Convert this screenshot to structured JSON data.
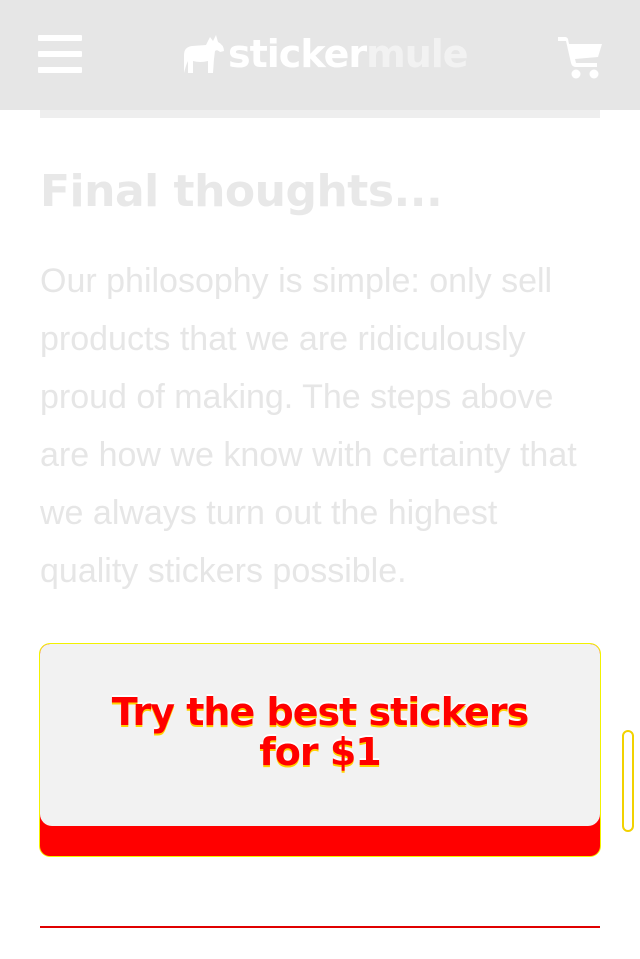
{
  "header": {
    "logo": {
      "part1": "sticker",
      "part2": "mule"
    },
    "menu_icon": "hamburger-menu-icon",
    "cart_icon": "shopping-cart-icon"
  },
  "article": {
    "heading": "Final thoughts...",
    "paragraph": "Our philosophy is simple: only sell products that we are ridiculously proud of making. The steps above are how we know with certainty that we always turn out the highest quality stickers possible."
  },
  "cta": {
    "line1": "Try the best stickers",
    "line2": "for $1"
  },
  "colors": {
    "header_bg": "#e6e6e6",
    "accent_red": "#ff0000",
    "faded_text": "#e6e6e6",
    "cta_face": "#f2f2f2"
  }
}
